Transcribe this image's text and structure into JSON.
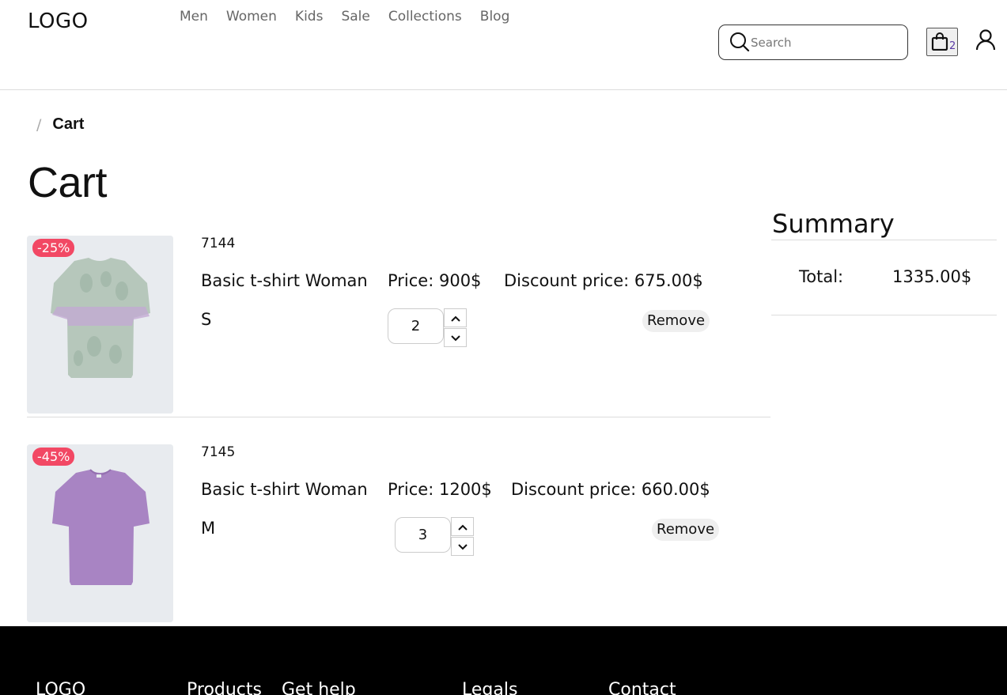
{
  "header": {
    "logo": "LOGO",
    "nav": [
      "Men",
      "Women",
      "Kids",
      "Sale",
      "Collections",
      "Blog"
    ],
    "search_placeholder": "Search",
    "cart_count": "2",
    "icons": [
      "search-icon",
      "shopping-bag-icon",
      "user-icon"
    ]
  },
  "breadcrumb": {
    "separator": "/",
    "current": "Cart"
  },
  "page_title": "Cart",
  "items": [
    {
      "sku": "7144",
      "badge": "-25%",
      "name": "Basic t-shirt Woman",
      "price": "Price: 900$",
      "discount_price": "Discount price: 675.00$",
      "size": "S",
      "quantity": "2",
      "remove_label": "Remove",
      "image_color": "#a9b9ae"
    },
    {
      "sku": "7145",
      "badge": "-45%",
      "name": "Basic t-shirt Woman",
      "price": "Price: 1200$",
      "discount_price": "Discount price: 660.00$",
      "size": "M",
      "quantity": "3",
      "remove_label": "Remove",
      "image_color": "#a884c3"
    }
  ],
  "summary": {
    "title": "Summary",
    "total_label": "Total:",
    "total_value": "1335.00$"
  },
  "footer": {
    "logo": "LOGO",
    "columns": [
      "Products",
      "Get help",
      "Legals",
      "Contact"
    ]
  },
  "colors": {
    "badge": "#f24864",
    "footer_bg": "#000000",
    "cart_count": "#5b3aa5"
  }
}
